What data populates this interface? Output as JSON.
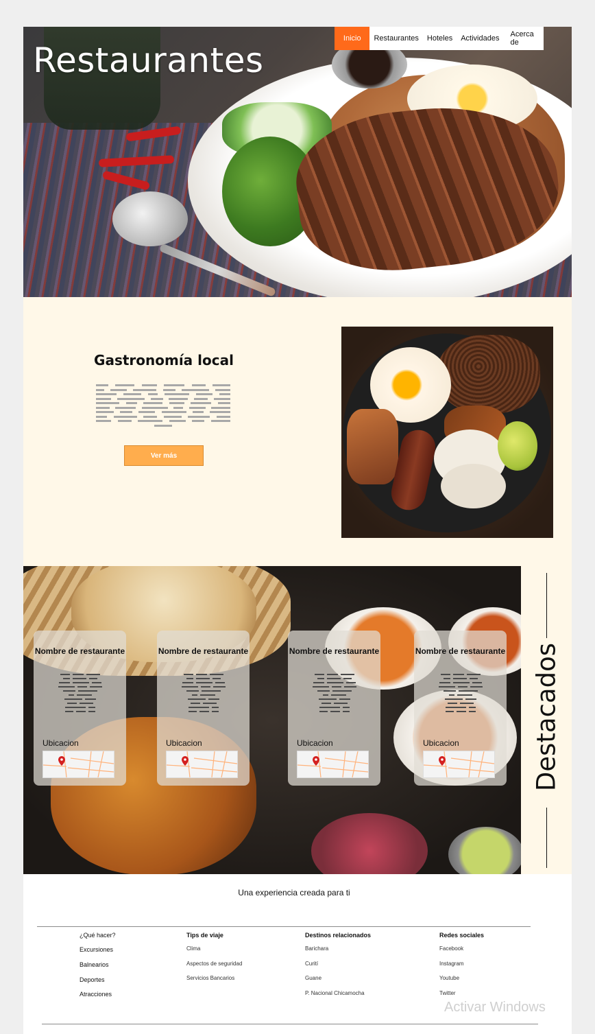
{
  "hero": {
    "title": "Restaurantes"
  },
  "nav": {
    "items": [
      {
        "label": "Inicio",
        "active": true
      },
      {
        "label": "Restaurantes"
      },
      {
        "label": "Hoteles"
      },
      {
        "label": "Actividades"
      },
      {
        "label": "Acerca de"
      }
    ],
    "active_color": "#ff6a1a"
  },
  "gastro": {
    "title": "Gastronomía local",
    "button": "Ver más",
    "button_color": "#ffad4d",
    "background": "#fff8e8"
  },
  "destacados": {
    "side_title": "Destacados",
    "cards": [
      {
        "name": "Nombre de restaurante",
        "location_label": "Ubicacion"
      },
      {
        "name": "Nombre de restaurante",
        "location_label": "Ubicacion"
      },
      {
        "name": "Nombre de restaurante",
        "location_label": "Ubicacion"
      },
      {
        "name": "Nombre de restaurante",
        "location_label": "Ubicacion"
      }
    ]
  },
  "footer": {
    "tagline": "Una experiencia creada para ti",
    "columns": [
      {
        "heading": "¿Qué hacer?",
        "links": [
          "Excursiones",
          "Balnearios",
          "Deportes",
          "Atracciones"
        ]
      },
      {
        "heading": "Tips de viaje",
        "links": [
          "Clima",
          "Aspectos de seguridad",
          "Servicios Bancarios"
        ]
      },
      {
        "heading": "Destinos relacionados",
        "links": [
          "Barichara",
          "Curití",
          "Guane",
          "P. Nacional Chicamocha"
        ]
      },
      {
        "heading": "Redes sociales",
        "links": [
          "Facebook",
          "Instagram",
          "Youtube",
          "Twitter"
        ]
      }
    ]
  },
  "watermark": "Activar Windows"
}
